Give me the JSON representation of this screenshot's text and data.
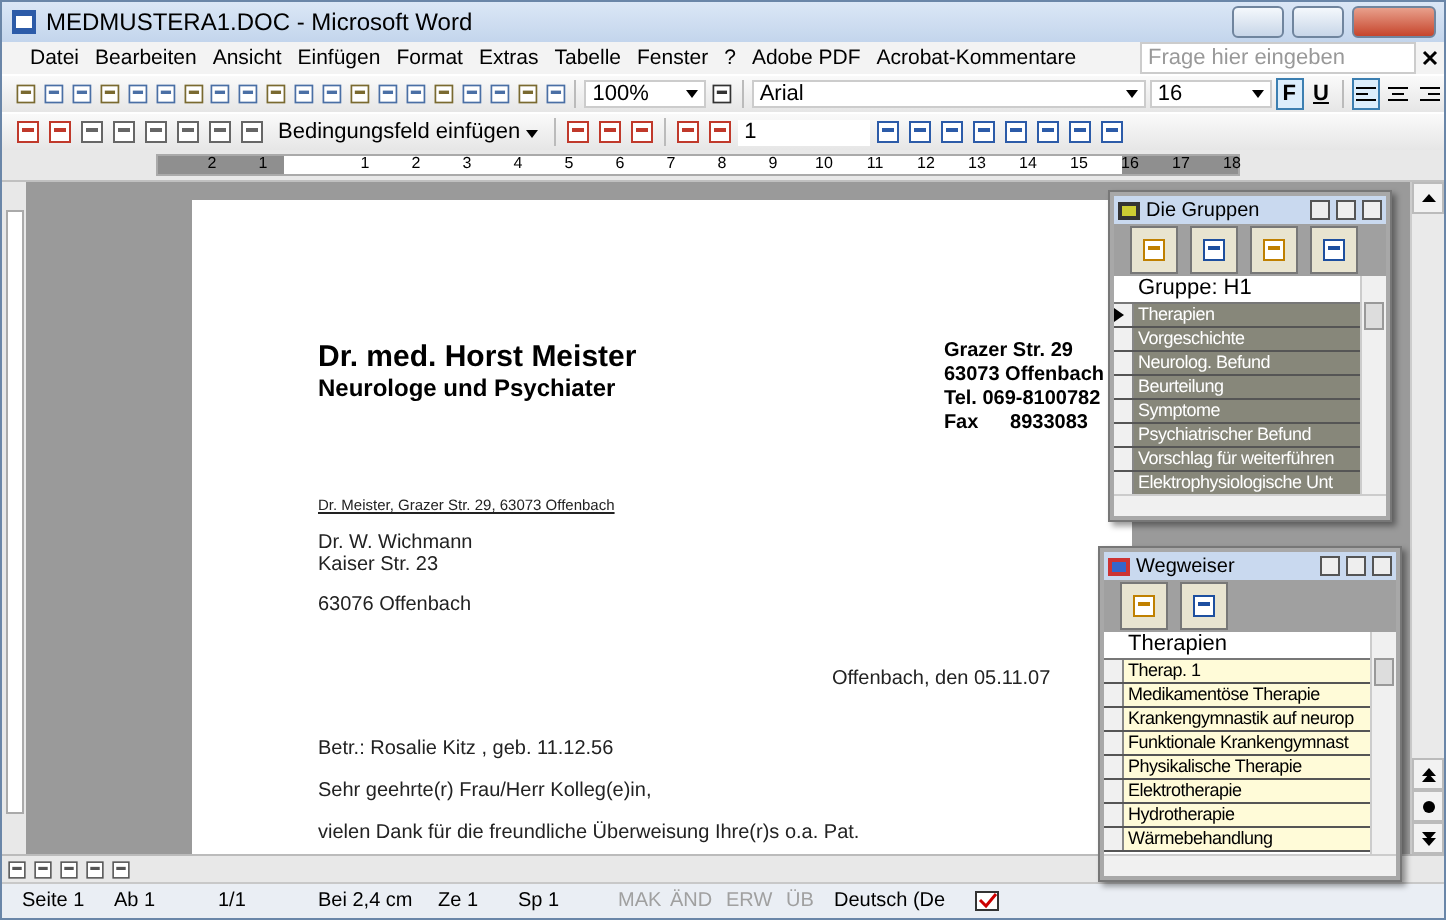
{
  "window": {
    "title": "MEDMUSTERA1.DOC - Microsoft Word"
  },
  "menu": [
    "Datei",
    "Bearbeiten",
    "Ansicht",
    "Einfügen",
    "Format",
    "Extras",
    "Tabelle",
    "Fenster",
    "?",
    "Adobe PDF",
    "Acrobat-Kommentare"
  ],
  "help_field": {
    "placeholder": "Frage hier eingeben"
  },
  "toolbar": {
    "zoom": "100%",
    "font": "Arial",
    "size": "16",
    "bold": {
      "label": "F",
      "pressed": true
    },
    "underline": {
      "label": "U",
      "pressed": false
    },
    "align_buttons": [
      {
        "selected": true
      },
      {
        "selected": false
      },
      {
        "selected": false
      }
    ]
  },
  "toolbar2": {
    "field_menu": "Bedingungsfeld einfügen",
    "page_field": "1"
  },
  "ruler": [
    "2",
    "1",
    "1",
    "2",
    "3",
    "4",
    "5",
    "6",
    "7",
    "8",
    "9",
    "10",
    "11",
    "12",
    "13",
    "14",
    "15",
    "16",
    "17",
    "18"
  ],
  "document": {
    "name": "Dr. med. Horst Meister",
    "title": "Neurologe und Psychiater",
    "address": [
      "Grazer Str. 29",
      "63073 Offenbach",
      "Tel. 069-8100782"
    ],
    "fax_label": "Fax",
    "fax": "8933083",
    "return_address": "Dr. Meister, Grazer Str. 29, 63073 Offenbach",
    "recipient": [
      "Dr. W. Wichmann",
      "Kaiser Str. 23"
    ],
    "recipient_city": "63076 Offenbach",
    "date": "Offenbach, den 05.11.07",
    "paragraphs": [
      "Betr.: Rosalie Kitz , geb. 11.12.56",
      "Sehr geehrte(r) Frau/Herr Kolleg(e)in,",
      "vielen Dank für die freundliche Überweisung Ihre(r)s o.a. Pat."
    ]
  },
  "groups_panel": {
    "title": "Die Gruppen",
    "header": "Gruppe: H1",
    "rows": [
      {
        "label": "Therapien",
        "selected": true
      },
      {
        "label": "Vorgeschichte",
        "selected": false
      },
      {
        "label": "Neurolog. Befund",
        "selected": false
      },
      {
        "label": "Beurteilung",
        "selected": false
      },
      {
        "label": "Symptome",
        "selected": false
      },
      {
        "label": "Psychiatrischer Befund",
        "selected": false
      },
      {
        "label": "Vorschlag für weiterführen",
        "selected": false
      },
      {
        "label": "Elektrophysiologische Unt",
        "selected": false
      }
    ]
  },
  "guide_panel": {
    "title": "Wegweiser",
    "header": "Therapien",
    "rows": [
      "Therap. 1",
      "Medikamentöse Therapie",
      "Krankengymnastik auf neurop",
      "Funktionale Krankengymnast",
      "Physikalische Therapie",
      "Elektrotherapie",
      "Hydrotherapie",
      "Wärmebehandlung"
    ]
  },
  "status_bar": [
    {
      "text": "Seite 1",
      "disabled": false
    },
    {
      "text": "Ab 1",
      "disabled": false
    },
    {
      "text": "1/1",
      "disabled": false
    },
    {
      "text": "Bei 2,4 cm",
      "disabled": false
    },
    {
      "text": "Ze 1",
      "disabled": false
    },
    {
      "text": "Sp 1",
      "disabled": false
    },
    {
      "text": "MAK",
      "disabled": true
    },
    {
      "text": "ÄND",
      "disabled": true
    },
    {
      "text": "ERW",
      "disabled": true
    },
    {
      "text": "ÜB",
      "disabled": true
    },
    {
      "text": "Deutsch (De",
      "disabled": false
    }
  ]
}
